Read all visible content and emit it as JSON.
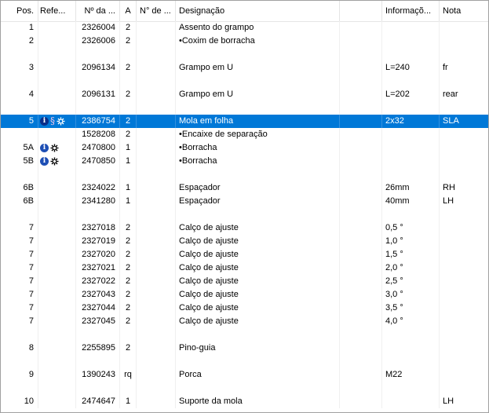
{
  "columns": [
    {
      "key": "pos",
      "label": "Pos."
    },
    {
      "key": "ref",
      "label": "Refe..."
    },
    {
      "key": "num",
      "label": "Nº da ..."
    },
    {
      "key": "a",
      "label": "A"
    },
    {
      "key": "n",
      "label": "N° de ..."
    },
    {
      "key": "des",
      "label": "Designação"
    },
    {
      "key": "extra",
      "label": ""
    },
    {
      "key": "info",
      "label": "Informaçõ..."
    },
    {
      "key": "nota",
      "label": "Nota"
    }
  ],
  "rows": [
    {
      "pos": "1",
      "icons": [],
      "num": "2326004",
      "a": "2",
      "n": "",
      "des": "Assento do grampo",
      "info": "",
      "nota": ""
    },
    {
      "pos": "2",
      "icons": [],
      "num": "2326006",
      "a": "2",
      "n": "",
      "des": "•Coxim de borracha",
      "info": "",
      "nota": ""
    },
    {
      "blank": true
    },
    {
      "pos": "3",
      "icons": [],
      "num": "2096134",
      "a": "2",
      "n": "",
      "des": "Grampo em U",
      "info": "L=240",
      "nota": "fr"
    },
    {
      "blank": true
    },
    {
      "pos": "4",
      "icons": [],
      "num": "2096131",
      "a": "2",
      "n": "",
      "des": "Grampo em U",
      "info": "L=202",
      "nota": "rear"
    },
    {
      "blank": true
    },
    {
      "pos": "5",
      "icons": [
        "info",
        "para",
        "gear"
      ],
      "num": "2386754",
      "a": "2",
      "n": "",
      "des": "Mola em folha",
      "info": "2x32",
      "nota": "SLA",
      "selected": true
    },
    {
      "pos": "",
      "icons": [],
      "num": "1528208",
      "a": "2",
      "n": "",
      "des": "•Encaixe de separação",
      "info": "",
      "nota": ""
    },
    {
      "pos": "5A",
      "icons": [
        "info",
        "gear"
      ],
      "num": "2470800",
      "a": "1",
      "n": "",
      "des": "•Borracha",
      "info": "",
      "nota": ""
    },
    {
      "pos": "5B",
      "icons": [
        "info",
        "gear"
      ],
      "num": "2470850",
      "a": "1",
      "n": "",
      "des": "•Borracha",
      "info": "",
      "nota": ""
    },
    {
      "blank": true
    },
    {
      "pos": "6B",
      "icons": [],
      "num": "2324022",
      "a": "1",
      "n": "",
      "des": "Espaçador",
      "info": "26mm",
      "nota": "RH"
    },
    {
      "pos": "6B",
      "icons": [],
      "num": "2341280",
      "a": "1",
      "n": "",
      "des": "Espaçador",
      "info": "40mm",
      "nota": "LH"
    },
    {
      "blank": true
    },
    {
      "pos": "7",
      "icons": [],
      "num": "2327018",
      "a": "2",
      "n": "",
      "des": "Calço de ajuste",
      "info": "0,5 °",
      "nota": ""
    },
    {
      "pos": "7",
      "icons": [],
      "num": "2327019",
      "a": "2",
      "n": "",
      "des": "Calço de ajuste",
      "info": "1,0 °",
      "nota": ""
    },
    {
      "pos": "7",
      "icons": [],
      "num": "2327020",
      "a": "2",
      "n": "",
      "des": "Calço de ajuste",
      "info": "1,5 °",
      "nota": ""
    },
    {
      "pos": "7",
      "icons": [],
      "num": "2327021",
      "a": "2",
      "n": "",
      "des": "Calço de ajuste",
      "info": "2,0 °",
      "nota": ""
    },
    {
      "pos": "7",
      "icons": [],
      "num": "2327022",
      "a": "2",
      "n": "",
      "des": "Calço de ajuste",
      "info": "2,5 °",
      "nota": ""
    },
    {
      "pos": "7",
      "icons": [],
      "num": "2327043",
      "a": "2",
      "n": "",
      "des": "Calço de ajuste",
      "info": "3,0 °",
      "nota": ""
    },
    {
      "pos": "7",
      "icons": [],
      "num": "2327044",
      "a": "2",
      "n": "",
      "des": "Calço de ajuste",
      "info": "3,5 °",
      "nota": ""
    },
    {
      "pos": "7",
      "icons": [],
      "num": "2327045",
      "a": "2",
      "n": "",
      "des": "Calço de ajuste",
      "info": "4,0 °",
      "nota": ""
    },
    {
      "blank": true
    },
    {
      "pos": "8",
      "icons": [],
      "num": "2255895",
      "a": "2",
      "n": "",
      "des": "Pino-guia",
      "info": "",
      "nota": ""
    },
    {
      "blank": true
    },
    {
      "pos": "9",
      "icons": [],
      "num": "1390243",
      "a": "rq",
      "n": "",
      "des": "Porca",
      "info": "M22",
      "nota": ""
    },
    {
      "blank": true
    },
    {
      "pos": "10",
      "icons": [],
      "num": "2474647",
      "a": "1",
      "n": "",
      "des": "Suporte da mola",
      "info": "",
      "nota": "LH"
    }
  ],
  "icons": {
    "info": {
      "name": "info-icon",
      "glyph": "i",
      "color": "#1e4fb5"
    },
    "para": {
      "name": "section-icon",
      "glyph": "§",
      "color": "#8b1a6b"
    },
    "gear": {
      "name": "gear-icon",
      "color": "#000000"
    }
  },
  "colors": {
    "selection": "#0078d7"
  }
}
